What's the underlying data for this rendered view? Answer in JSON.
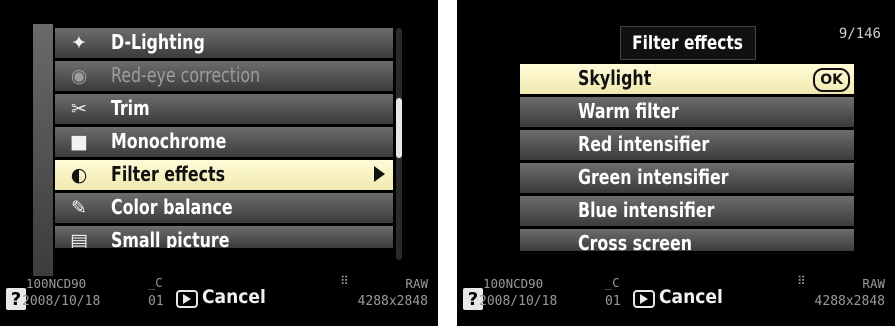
{
  "left": {
    "menu": [
      {
        "icon": "d-lighting-icon",
        "glyph": "✦",
        "label": "D-Lighting",
        "state": "normal"
      },
      {
        "icon": "eye-icon",
        "glyph": "◉",
        "label": "Red-eye correction",
        "state": "disabled"
      },
      {
        "icon": "scissors-icon",
        "glyph": "✂",
        "label": "Trim",
        "state": "normal"
      },
      {
        "icon": "monochrome-icon",
        "glyph": "■",
        "label": "Monochrome",
        "state": "normal"
      },
      {
        "icon": "filter-icon",
        "glyph": "◐",
        "label": "Filter effects",
        "state": "selected"
      },
      {
        "icon": "color-balance-icon",
        "glyph": "✎",
        "label": "Color balance",
        "state": "normal"
      },
      {
        "icon": "small-picture-icon",
        "glyph": "▤",
        "label": "Small picture",
        "state": "normal"
      }
    ],
    "status": {
      "help": "?",
      "folder": "100NCD90",
      "date": "2008/10/18",
      "c_mark": "_C",
      "frame": "01",
      "cancel": "Cancel",
      "quality": "RAW",
      "resolution": "4288x2848"
    }
  },
  "right": {
    "title": "Filter effects",
    "page": "9/146",
    "ok": "OK",
    "options": [
      {
        "label": "Skylight",
        "state": "selected"
      },
      {
        "label": "Warm filter",
        "state": "normal"
      },
      {
        "label": "Red intensifier",
        "state": "normal"
      },
      {
        "label": "Green intensifier",
        "state": "normal"
      },
      {
        "label": "Blue intensifier",
        "state": "normal"
      },
      {
        "label": "Cross screen",
        "state": "normal"
      }
    ],
    "status": {
      "help": "?",
      "folder": "100NCD90",
      "date": "2008/10/18",
      "c_mark": "_C",
      "frame": "01",
      "cancel": "Cancel",
      "quality": "RAW",
      "resolution": "4288x2848"
    }
  }
}
